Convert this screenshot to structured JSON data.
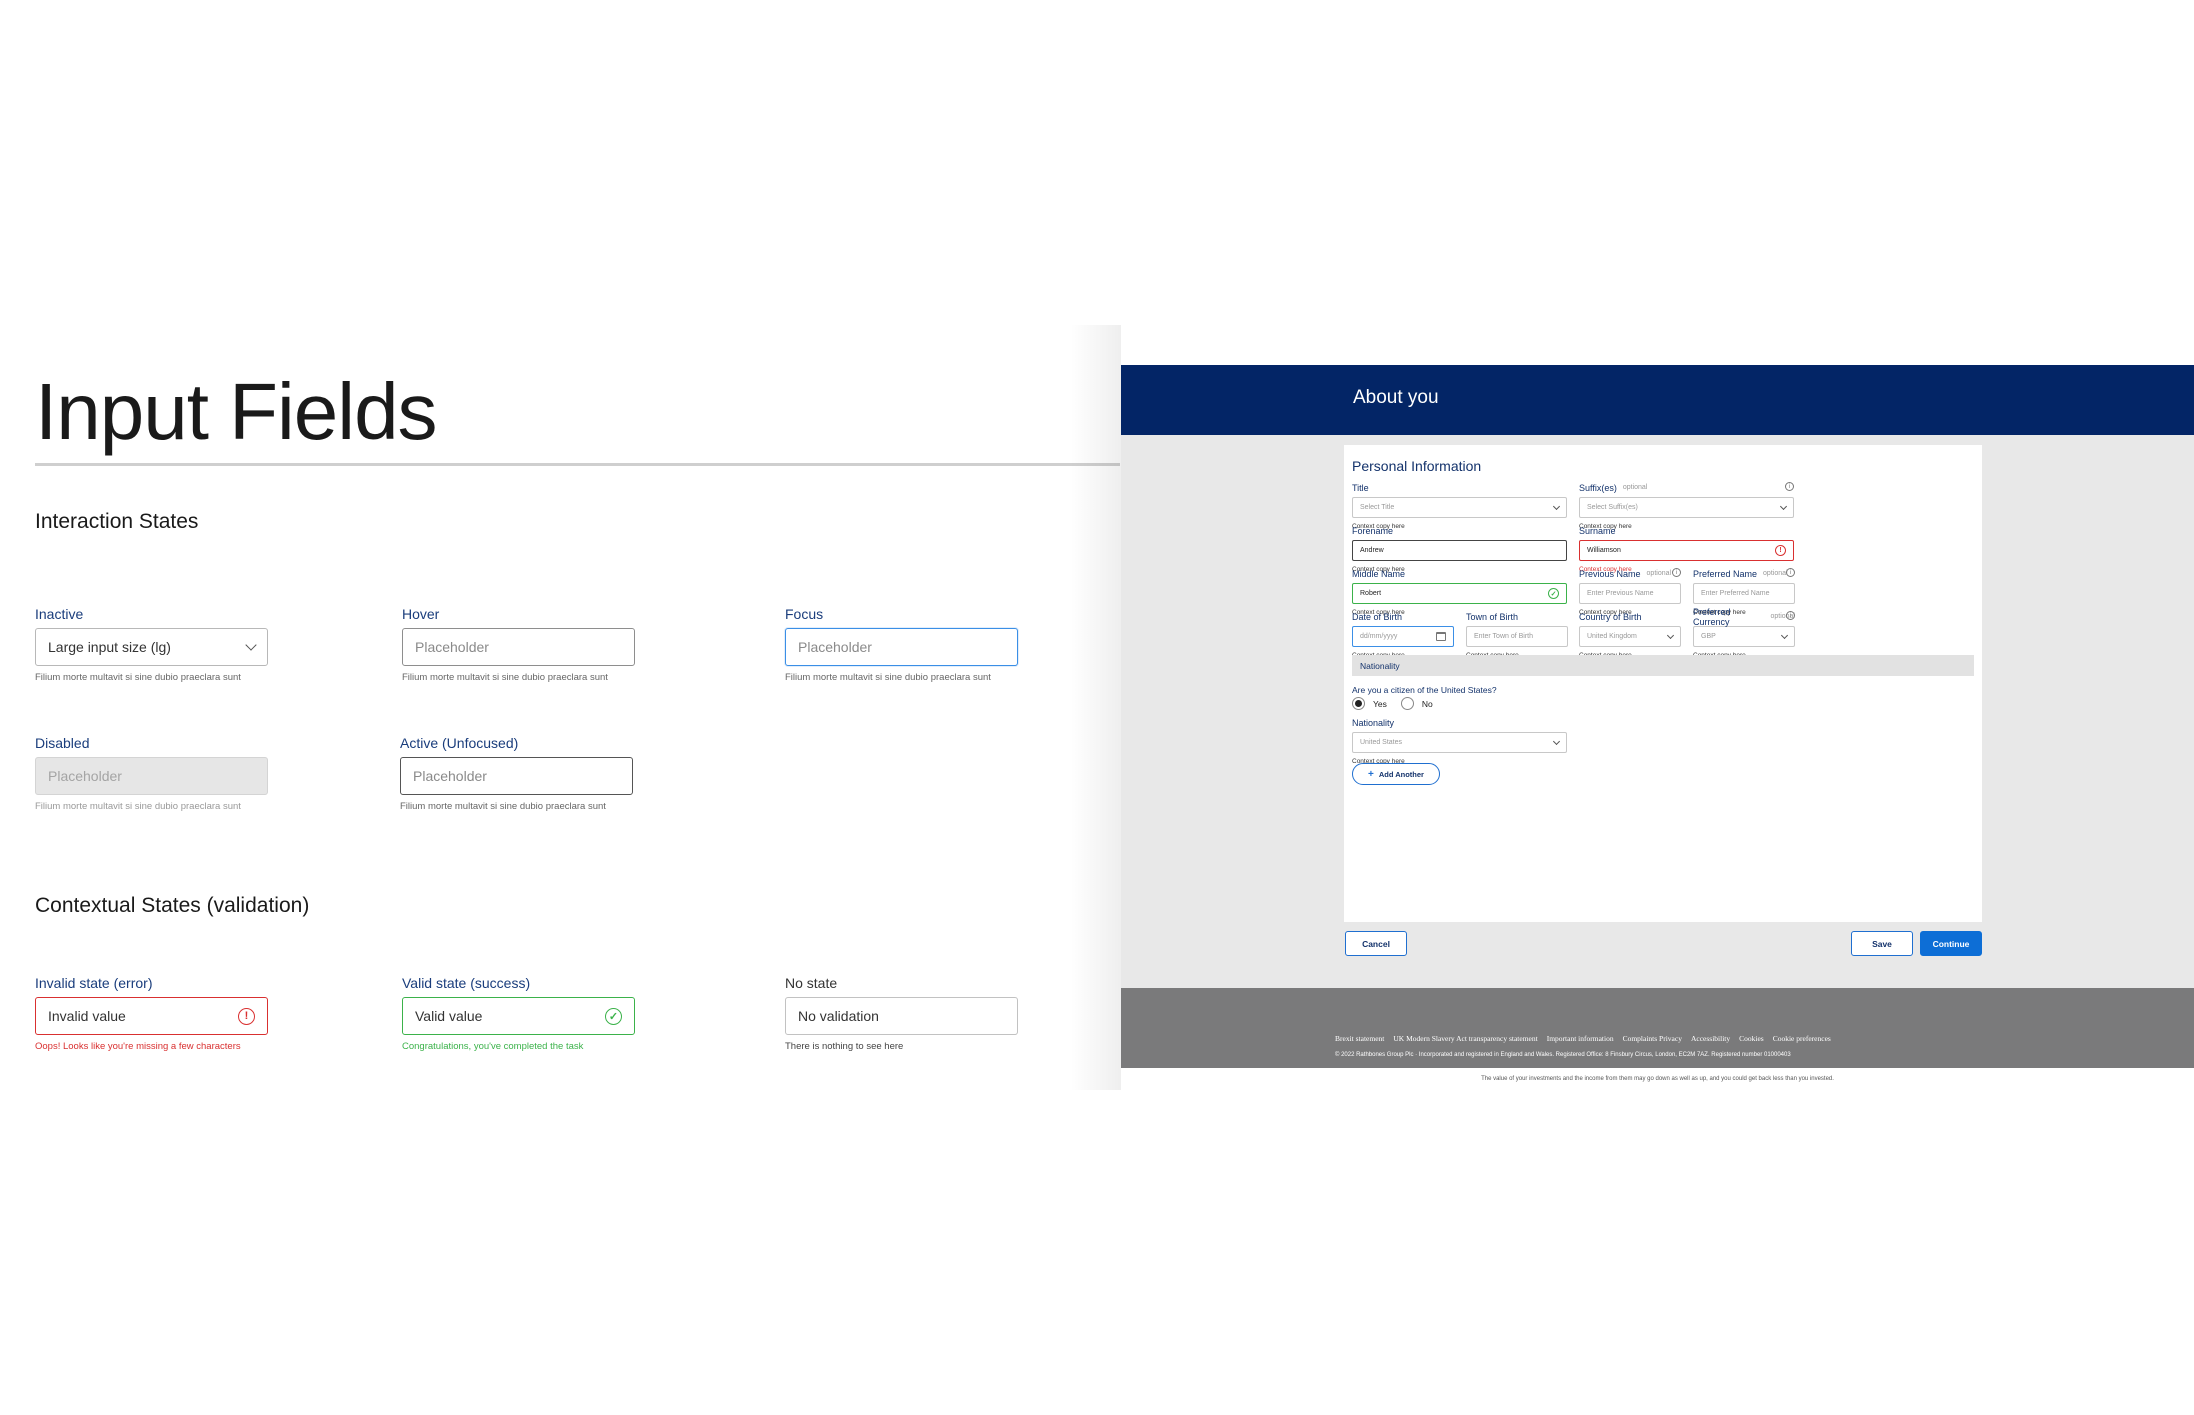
{
  "spec": {
    "title": "Input Fields",
    "interaction_heading": "Interaction States",
    "contextual_heading": "Contextual States (validation)",
    "inactive": {
      "label": "Inactive",
      "value": "Large input size (lg)",
      "help": "Filium morte multavit si sine dubio praeclara sunt"
    },
    "hover": {
      "label": "Hover",
      "placeholder": "Placeholder",
      "help": "Filium morte multavit si sine dubio praeclara sunt"
    },
    "focus": {
      "label": "Focus",
      "placeholder": "Placeholder",
      "help": "Filium morte multavit si sine dubio praeclara sunt"
    },
    "disabled": {
      "label": "Disabled",
      "placeholder": "Placeholder",
      "help": "Filium morte multavit si sine dubio praeclara sunt"
    },
    "active": {
      "label": "Active (Unfocused)",
      "placeholder": "Placeholder",
      "help": "Filium morte multavit si sine dubio praeclara sunt"
    },
    "invalid": {
      "label": "Invalid state (error)",
      "value": "Invalid value",
      "help": "Oops! Looks like you're missing a few characters"
    },
    "valid": {
      "label": "Valid state (success)",
      "value": "Valid value",
      "help": "Congratulations, you've completed the task"
    },
    "nostate": {
      "label": "No state",
      "value": "No validation",
      "help": "There is nothing to see here"
    }
  },
  "form": {
    "header_title": "About you",
    "card_title": "Personal Information",
    "optional_label": "optional",
    "context_copy": "Context copy here",
    "title_field": {
      "label": "Title",
      "placeholder": "Select Title"
    },
    "suffix_field": {
      "label": "Suffix(es)",
      "placeholder": "Select Suffix(es)"
    },
    "forename_field": {
      "label": "Forename",
      "value": "Andrew"
    },
    "surname_field": {
      "label": "Surname",
      "value": "Williamson"
    },
    "middle_field": {
      "label": "Middle Name",
      "value": "Robert"
    },
    "previous_field": {
      "label": "Previous Name",
      "placeholder": "Enter Previous Name"
    },
    "preferred_field": {
      "label": "Preferred Name",
      "placeholder": "Enter Preferred Name"
    },
    "dob_field": {
      "label": "Date of Birth",
      "placeholder": "dd/mm/yyyy"
    },
    "town_field": {
      "label": "Town of Birth",
      "placeholder": "Enter Town of Birth"
    },
    "country_field": {
      "label": "Country of Birth",
      "value": "United Kingdom"
    },
    "currency_field": {
      "label": "Preferred Currency",
      "value": "GBP"
    },
    "nationality_section": "Nationality",
    "citizen_question": "Are you a citizen of the United States?",
    "yes_label": "Yes",
    "no_label": "No",
    "nationality_field": {
      "label": "Nationality",
      "value": "United States"
    },
    "add_another": "Add Another",
    "cancel": "Cancel",
    "save": "Save",
    "continue": "Continue"
  },
  "footer": {
    "links": [
      "Brexit statement",
      "UK Modern Slavery Act transparency statement",
      "Important information",
      "Complaints Privacy",
      "Accessibility",
      "Cookies",
      "Cookie preferences"
    ],
    "copyright": "© 2022 Rathbones Group Plc · Incorporated and registered in England and Wales. Registered Office: 8 Finsbury Circus, London, EC2M 7AZ. Registered number 01000403",
    "disclaimer": "The value of your investments and the income from them may go down as well as up, and you could get back less than you invested."
  },
  "colors": {
    "header_navy": "#032566",
    "primary_blue": "#0d6ed6",
    "error_red": "#d93030",
    "success_green": "#3bb24a",
    "focus_blue": "#3b8fe6"
  }
}
